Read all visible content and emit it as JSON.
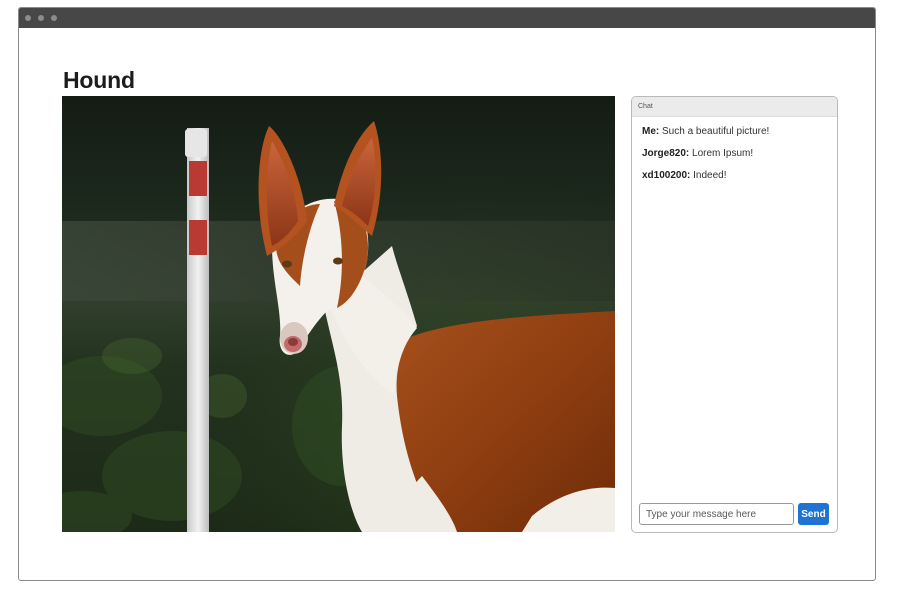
{
  "window": {
    "titlebar_controls": [
      "dot",
      "dot",
      "dot"
    ]
  },
  "page": {
    "title": "Hound"
  },
  "image": {
    "subject": "ibizan-hound-photo"
  },
  "chat": {
    "header": "Chat",
    "messages": [
      {
        "author": "Me:",
        "text": "Such a beautiful picture!"
      },
      {
        "author": "Jorge820:",
        "text": "Lorem Ipsum!"
      },
      {
        "author": "xd100200:",
        "text": "Indeed!"
      }
    ],
    "input_placeholder": "Type your message here",
    "input_value": "",
    "send_label": "Send"
  },
  "colors": {
    "titlebar": "#474747",
    "send_button": "#1f74d1",
    "chat_header": "#ebebeb"
  }
}
